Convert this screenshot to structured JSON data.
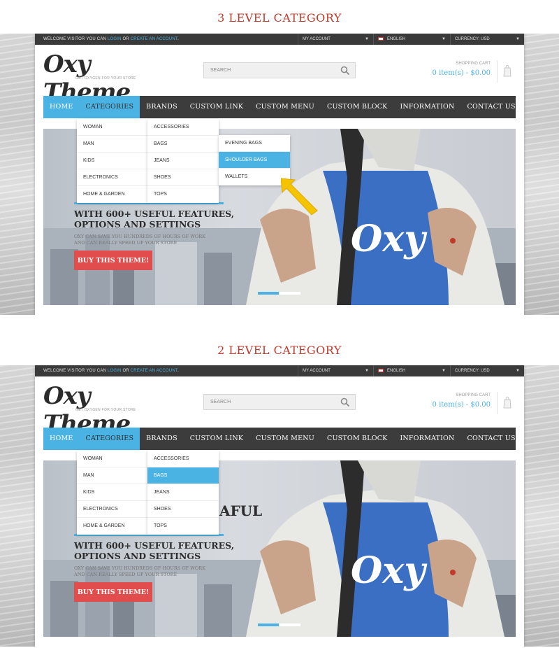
{
  "sections": [
    {
      "title": "3 LEVEL CATEGORY",
      "topbar": {
        "welcome_prefix": "WELCOME VISITOR YOU CAN ",
        "login": "LOGIN",
        "or": " OR ",
        "create": "CREATE AN ACCOUNT",
        "period": ".",
        "account": "MY ACCOUNT",
        "language": "ENGLISH",
        "currency": "CURRENCY: USD"
      },
      "logo": {
        "text": "Oxy Theme",
        "dot": ".",
        "tagline": "GET OXYGEN FOR YOUR STORE"
      },
      "search": {
        "placeholder": "SEARCH"
      },
      "cart": {
        "label": "SHOPPING CART",
        "value": "0 item(s) - $0.00"
      },
      "nav": [
        "HOME",
        "CATEGORIES",
        "BRANDS",
        "CUSTOM LINK",
        "CUSTOM MENU",
        "CUSTOM BLOCK",
        "INFORMATION",
        "CONTACT US"
      ],
      "level1": [
        "WOMAN",
        "MAN",
        "KIDS",
        "ELECTRONICS",
        "HOME & GARDEN"
      ],
      "level2": [
        "ACCESSORIES",
        "BAGS",
        "JEANS",
        "SHOES",
        "TOPS"
      ],
      "level3": [
        "EVENING BAGS",
        "SHOULDER BAGS",
        "WALLETS"
      ],
      "hero": {
        "line1": "WITH 600+ USEFUL FEATURES,",
        "line2": "OPTIONS AND SETTINGS",
        "sub1": "OXY CAN SAVE YOU HUNDREDS OF HOURS OF WORK",
        "sub2": "AND CAN REALLY SPEED UP YOUR STORE",
        "button": "BUY THIS THEME!",
        "shirt_logo": "Oxy"
      }
    },
    {
      "title": "2 LEVEL CATEGORY",
      "topbar": {
        "welcome_prefix": "WELCOME VISITOR YOU CAN ",
        "login": "LOGIN",
        "or": " OR ",
        "create": "CREATE AN ACCOUNT",
        "period": ".",
        "account": "MY ACCOUNT",
        "language": "ENGLISH",
        "currency": "CURRENCY: USD"
      },
      "logo": {
        "text": "Oxy Theme",
        "dot": ".",
        "tagline": "GET OXYGEN FOR YOUR STORE"
      },
      "search": {
        "placeholder": "SEARCH"
      },
      "cart": {
        "label": "SHOPPING CART",
        "value": "0 item(s) - $0.00"
      },
      "nav": [
        "HOME",
        "CATEGORIES",
        "BRANDS",
        "CUSTOM LINK",
        "CUSTOM MENU",
        "CUSTOM BLOCK",
        "INFORMATION",
        "CONTACT US"
      ],
      "level1": [
        "WOMAN",
        "MAN",
        "KIDS",
        "ELECTRONICS",
        "HOME & GARDEN"
      ],
      "level2": [
        "ACCESSORIES",
        "BAGS",
        "JEANS",
        "SHOES",
        "TOPS"
      ],
      "hero": {
        "big": "AFUL",
        "line1": "WITH 600+ USEFUL FEATURES,",
        "line2": "OPTIONS AND SETTINGS",
        "sub1": "OXY CAN SAVE YOU HUNDREDS OF HOURS OF WORK",
        "sub2": "AND CAN REALLY SPEED UP YOUR STORE",
        "button": "BUY THIS THEME!",
        "shirt_logo": "Oxy"
      }
    }
  ],
  "colors": {
    "accent": "#4bb3e4",
    "brand_red": "#c0392b",
    "button_red": "#e14c4c",
    "nav_dark": "#3c3c3c",
    "arrow": "#f5c400"
  }
}
